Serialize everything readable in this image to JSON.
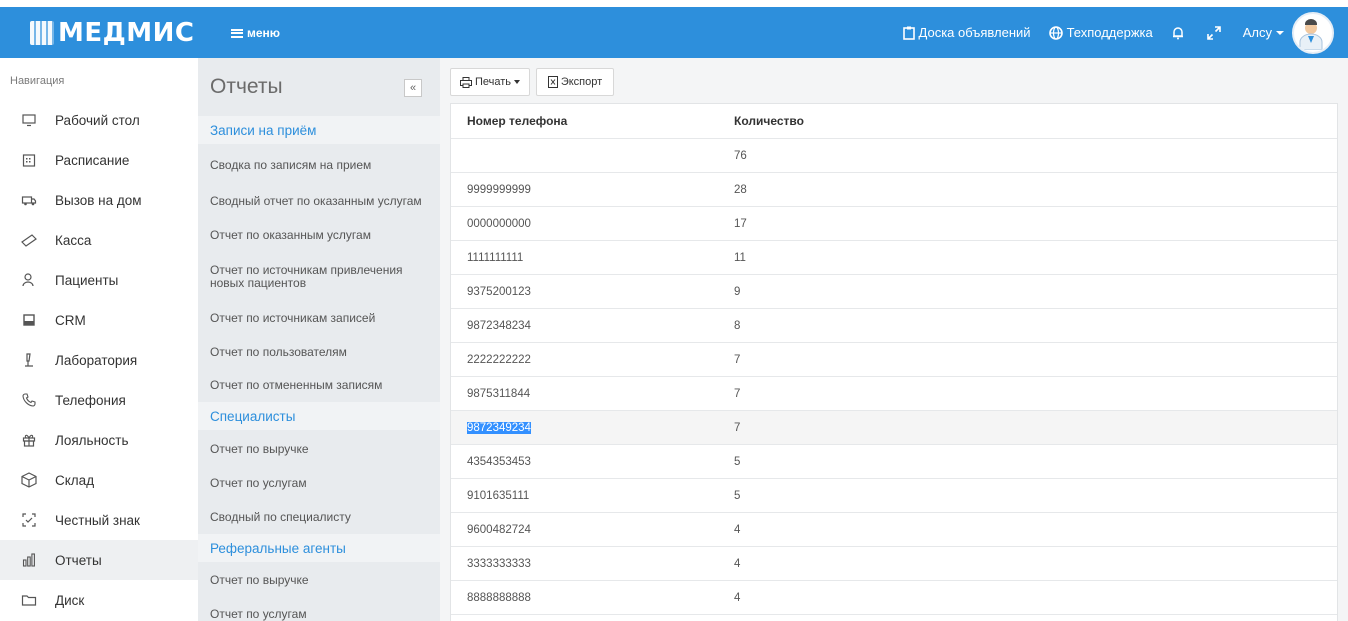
{
  "topbar": {
    "logo": "МЕДМИС",
    "menu_label": "меню",
    "board_label": "Доска объявлений",
    "support_label": "Техподдержка",
    "user_name": "Алсу"
  },
  "nav": {
    "heading": "Навигация",
    "items": [
      {
        "label": "Рабочий стол",
        "icon": "monitor-icon"
      },
      {
        "label": "Расписание",
        "icon": "calendar-icon"
      },
      {
        "label": "Вызов на дом",
        "icon": "ambulance-icon"
      },
      {
        "label": "Касса",
        "icon": "cash-icon"
      },
      {
        "label": "Пациенты",
        "icon": "users-icon"
      },
      {
        "label": "CRM",
        "icon": "crm-icon"
      },
      {
        "label": "Лаборатория",
        "icon": "microscope-icon"
      },
      {
        "label": "Телефония",
        "icon": "phone-icon"
      },
      {
        "label": "Лояльность",
        "icon": "gift-icon"
      },
      {
        "label": "Склад",
        "icon": "box-icon"
      },
      {
        "label": "Честный знак",
        "icon": "scan-icon"
      },
      {
        "label": "Отчеты",
        "icon": "bar-chart-icon"
      },
      {
        "label": "Диск",
        "icon": "folder-icon"
      }
    ]
  },
  "reports": {
    "title": "Отчеты",
    "collapse_label": "«",
    "sections": [
      {
        "title": "Записи на приём"
      },
      {
        "title": "Специалисты"
      },
      {
        "title": "Реферальные агенты"
      }
    ],
    "links": [
      "Сводка по записям на прием",
      "Сводный отчет по оказанным услугам",
      "Отчет по оказанным услугам",
      "Отчет по источникам привлечения новых пациентов",
      "Отчет по источникам записей",
      "Отчет по пользователям",
      "Отчет по отмененным записям",
      "Отчет по выручке",
      "Отчет по услугам",
      "Сводный по специалисту",
      "Отчет по выручке",
      "Отчет по услугам"
    ]
  },
  "toolbar": {
    "print_label": "Печать",
    "export_label": "Экспорт"
  },
  "table": {
    "columns": [
      "Номер телефона",
      "Количество"
    ],
    "rows": [
      {
        "phone": "",
        "count": "76"
      },
      {
        "phone": "9999999999",
        "count": "28"
      },
      {
        "phone": "0000000000",
        "count": "17"
      },
      {
        "phone": "1111111111",
        "count": "11"
      },
      {
        "phone": "9375200123",
        "count": "9"
      },
      {
        "phone": "9872348234",
        "count": "8"
      },
      {
        "phone": "2222222222",
        "count": "7"
      },
      {
        "phone": "9875311844",
        "count": "7"
      },
      {
        "phone": "9872349234",
        "count": "7"
      },
      {
        "phone": "4354353453",
        "count": "5"
      },
      {
        "phone": "9101635111",
        "count": "5"
      },
      {
        "phone": "9600482724",
        "count": "4"
      },
      {
        "phone": "3333333333",
        "count": "4"
      },
      {
        "phone": "8888888888",
        "count": "4"
      }
    ]
  },
  "colors": {
    "brand": "#2d8fdc",
    "selection": "#3390ff"
  }
}
